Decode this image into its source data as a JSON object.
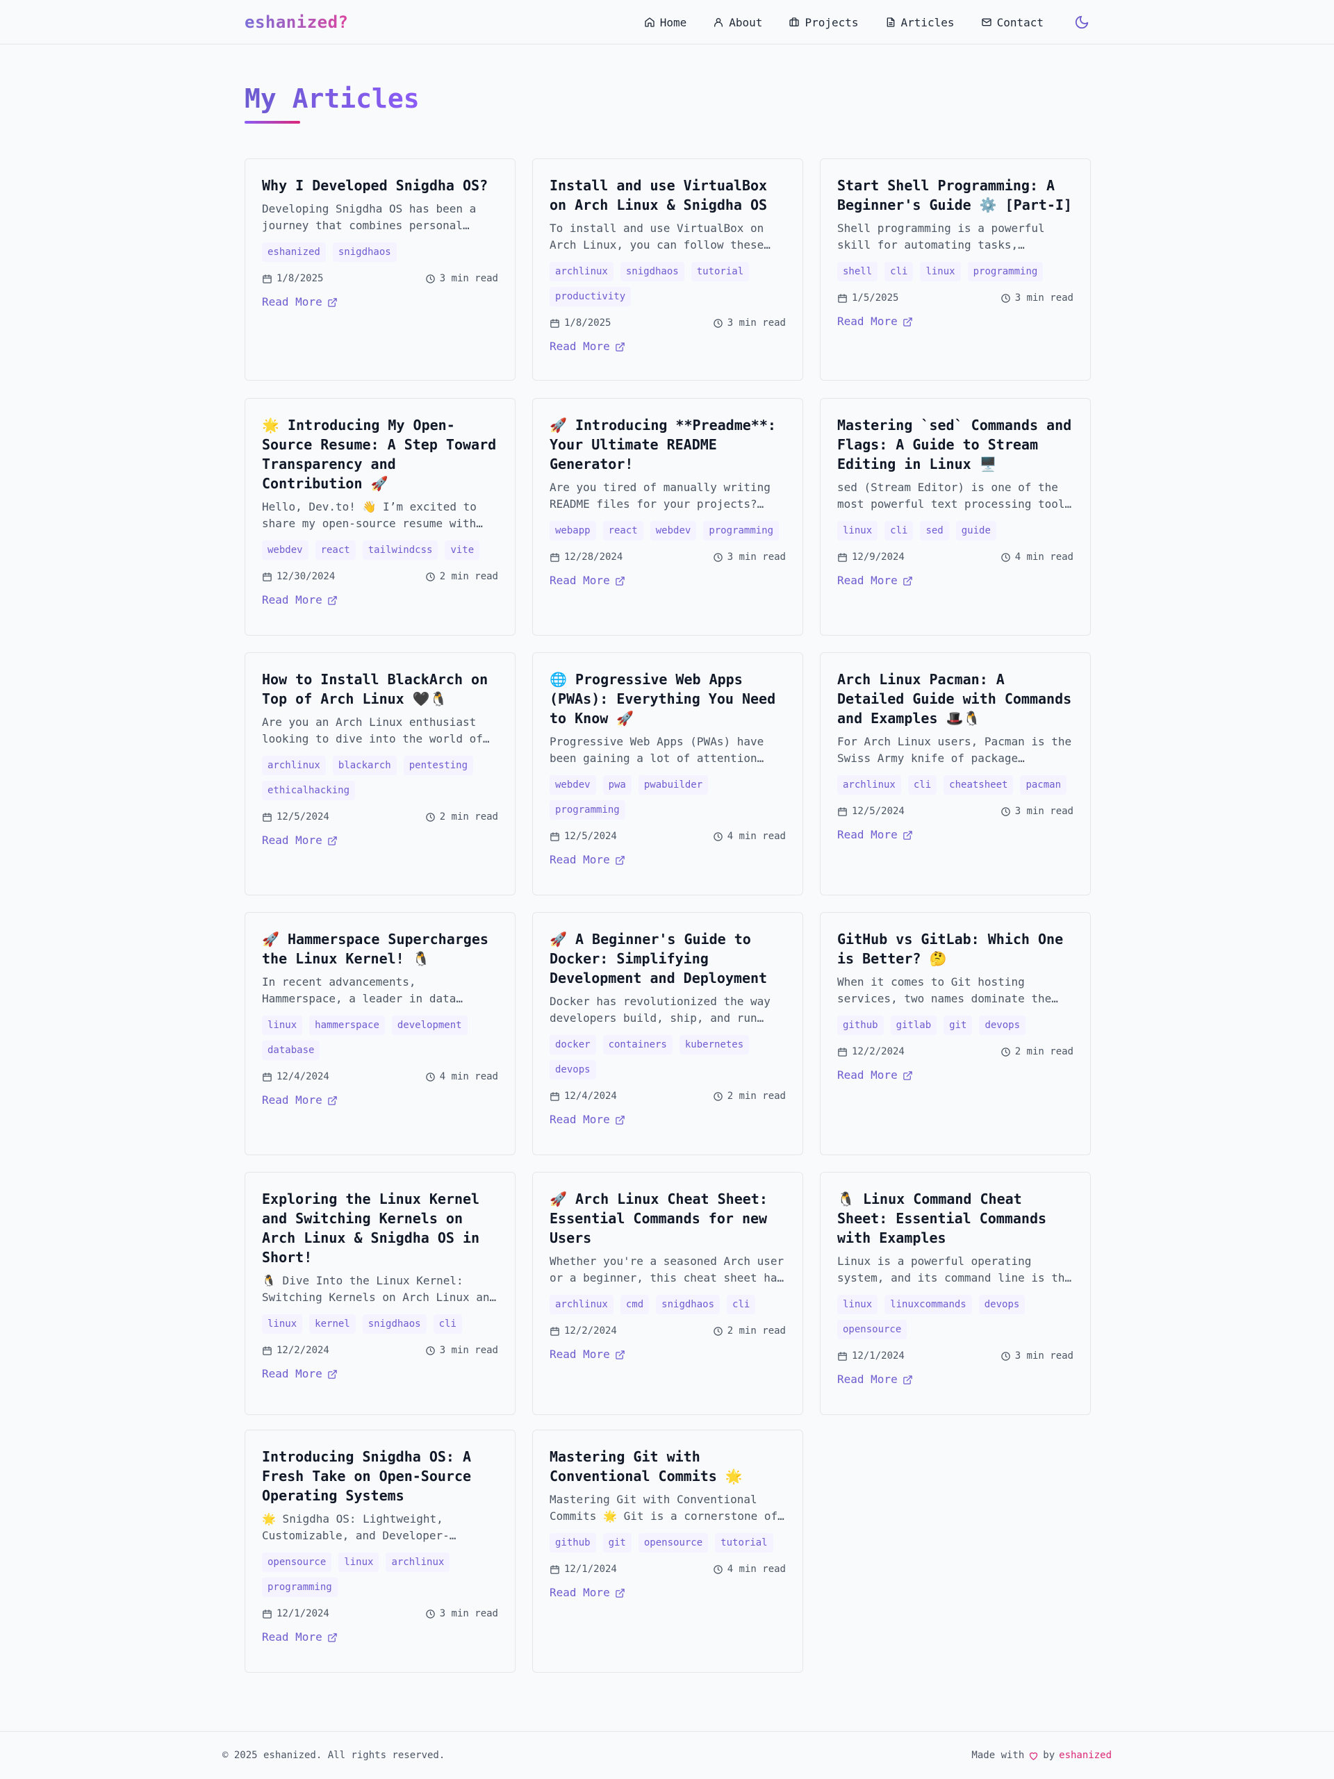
{
  "brand": {
    "logo": "eshanized?"
  },
  "nav": {
    "items": [
      {
        "label": "Home",
        "icon": "home-icon"
      },
      {
        "label": "About",
        "icon": "user-icon"
      },
      {
        "label": "Projects",
        "icon": "briefcase-icon"
      },
      {
        "label": "Articles",
        "icon": "file-text-icon"
      },
      {
        "label": "Contact",
        "icon": "mail-icon"
      }
    ],
    "theme_toggle_icon": "moon-icon"
  },
  "page": {
    "title": "My Articles"
  },
  "read_more_label": "Read More",
  "articles": [
    {
      "title": "Why I Developed Snigdha OS?",
      "desc": "Developing Snigdha OS has been a journey that combines personal passion with technical exploration.",
      "tags": [
        "eshanized",
        "snigdhaos"
      ],
      "date": "1/8/2025",
      "read": "3 min read"
    },
    {
      "title": "Install and use VirtualBox on Arch Linux & Snigdha OS",
      "desc": "To install and use VirtualBox on Arch Linux, you can follow these steps carefully.",
      "tags": [
        "archlinux",
        "snigdhaos",
        "tutorial",
        "productivity"
      ],
      "date": "1/8/2025",
      "read": "3 min read"
    },
    {
      "title": "Start Shell Programming: A Beginner's Guide ⚙️ [Part-I]",
      "desc": "Shell programming is a powerful skill for automating tasks, managing systems and more.",
      "tags": [
        "shell",
        "cli",
        "linux",
        "programming"
      ],
      "date": "1/5/2025",
      "read": "3 min read"
    },
    {
      "title": "🌟 Introducing My Open-Source Resume: A Step Toward Transparency and Contribution 🚀",
      "desc": "Hello, Dev.to! 👋 I’m excited to share my open-source resume with the community.",
      "tags": [
        "webdev",
        "react",
        "tailwindcss",
        "vite"
      ],
      "date": "12/30/2024",
      "read": "2 min read"
    },
    {
      "title": "🚀 Introducing **Preadme**: Your Ultimate README Generator!",
      "desc": "Are you tired of manually writing README files for your projects? Meet Preadme.",
      "tags": [
        "webapp",
        "react",
        "webdev",
        "programming"
      ],
      "date": "12/28/2024",
      "read": "3 min read"
    },
    {
      "title": "Mastering `sed` Commands and Flags: A Guide to Stream Editing in Linux 🖥️",
      "desc": "sed (Stream Editor) is one of the most powerful text processing tools in Linux.",
      "tags": [
        "linux",
        "cli",
        "sed",
        "guide"
      ],
      "date": "12/9/2024",
      "read": "4 min read"
    },
    {
      "title": "How to Install BlackArch on Top of Arch Linux 🖤🐧",
      "desc": "Are you an Arch Linux enthusiast looking to dive into the world of penetration testing?",
      "tags": [
        "archlinux",
        "blackarch",
        "pentesting",
        "ethicalhacking"
      ],
      "date": "12/5/2024",
      "read": "2 min read"
    },
    {
      "title": "🌐 Progressive Web Apps (PWAs): Everything You Need to Know 🚀",
      "desc": "Progressive Web Apps (PWAs) have been gaining a lot of attention recently.",
      "tags": [
        "webdev",
        "pwa",
        "pwabuilder",
        "programming"
      ],
      "date": "12/5/2024",
      "read": "4 min read"
    },
    {
      "title": "Arch Linux Pacman: A Detailed Guide with Commands and Examples 🎩🐧",
      "desc": "For Arch Linux users, Pacman is the Swiss Army knife of package management.",
      "tags": [
        "archlinux",
        "cli",
        "cheatsheet",
        "pacman"
      ],
      "date": "12/5/2024",
      "read": "3 min read"
    },
    {
      "title": "🚀 Hammerspace Supercharges the Linux Kernel! 🐧",
      "desc": "In recent advancements, Hammerspace, a leader in data orchestration, has contributed.",
      "tags": [
        "linux",
        "hammerspace",
        "development",
        "database"
      ],
      "date": "12/4/2024",
      "read": "4 min read"
    },
    {
      "title": "🚀 A Beginner's Guide to Docker: Simplifying Development and Deployment",
      "desc": "Docker has revolutionized the way developers build, ship, and run applications.",
      "tags": [
        "docker",
        "containers",
        "kubernetes",
        "devops"
      ],
      "date": "12/4/2024",
      "read": "2 min read"
    },
    {
      "title": "GitHub vs GitLab: Which One is Better? 🤔",
      "desc": "When it comes to Git hosting services, two names dominate the landscape.",
      "tags": [
        "github",
        "gitlab",
        "git",
        "devops"
      ],
      "date": "12/2/2024",
      "read": "2 min read"
    },
    {
      "title": "Exploring the Linux Kernel and Switching Kernels on Arch Linux & Snigdha OS in Short!",
      "desc": "🐧 Dive Into the Linux Kernel: Switching Kernels on Arch Linux and Snigdha OS.",
      "tags": [
        "linux",
        "kernel",
        "snigdhaos",
        "cli"
      ],
      "date": "12/2/2024",
      "read": "3 min read"
    },
    {
      "title": "🚀 Arch Linux Cheat Sheet: Essential Commands for new Users",
      "desc": "Whether you're a seasoned Arch user or a beginner, this cheat sheet has you covered.",
      "tags": [
        "archlinux",
        "cmd",
        "snigdhaos",
        "cli"
      ],
      "date": "12/2/2024",
      "read": "2 min read"
    },
    {
      "title": "🐧 Linux Command Cheat Sheet: Essential Commands with Examples",
      "desc": "Linux is a powerful operating system, and its command line is the heart of it.",
      "tags": [
        "linux",
        "linuxcommands",
        "devops",
        "opensource"
      ],
      "date": "12/1/2024",
      "read": "3 min read"
    },
    {
      "title": "Introducing Snigdha OS: A Fresh Take on Open-Source Operating Systems",
      "desc": "🌟 Snigdha OS: Lightweight, Customizable, and Developer-Friendly operating system.",
      "tags": [
        "opensource",
        "linux",
        "archlinux",
        "programming"
      ],
      "date": "12/1/2024",
      "read": "3 min read"
    },
    {
      "title": "Mastering Git with Conventional Commits 🌟",
      "desc": "Mastering Git with Conventional Commits 🌟 Git is a cornerstone of modern development.",
      "tags": [
        "github",
        "git",
        "opensource",
        "tutorial"
      ],
      "date": "12/1/2024",
      "read": "4 min read"
    }
  ],
  "footer": {
    "copyright": "© 2025 eshanized. All rights reserved.",
    "made_with": "Made with",
    "by": "by",
    "author": "eshanized"
  },
  "colors": {
    "accent": "#6d5bd0",
    "pink": "#db2777",
    "border": "#e5e7eb"
  }
}
